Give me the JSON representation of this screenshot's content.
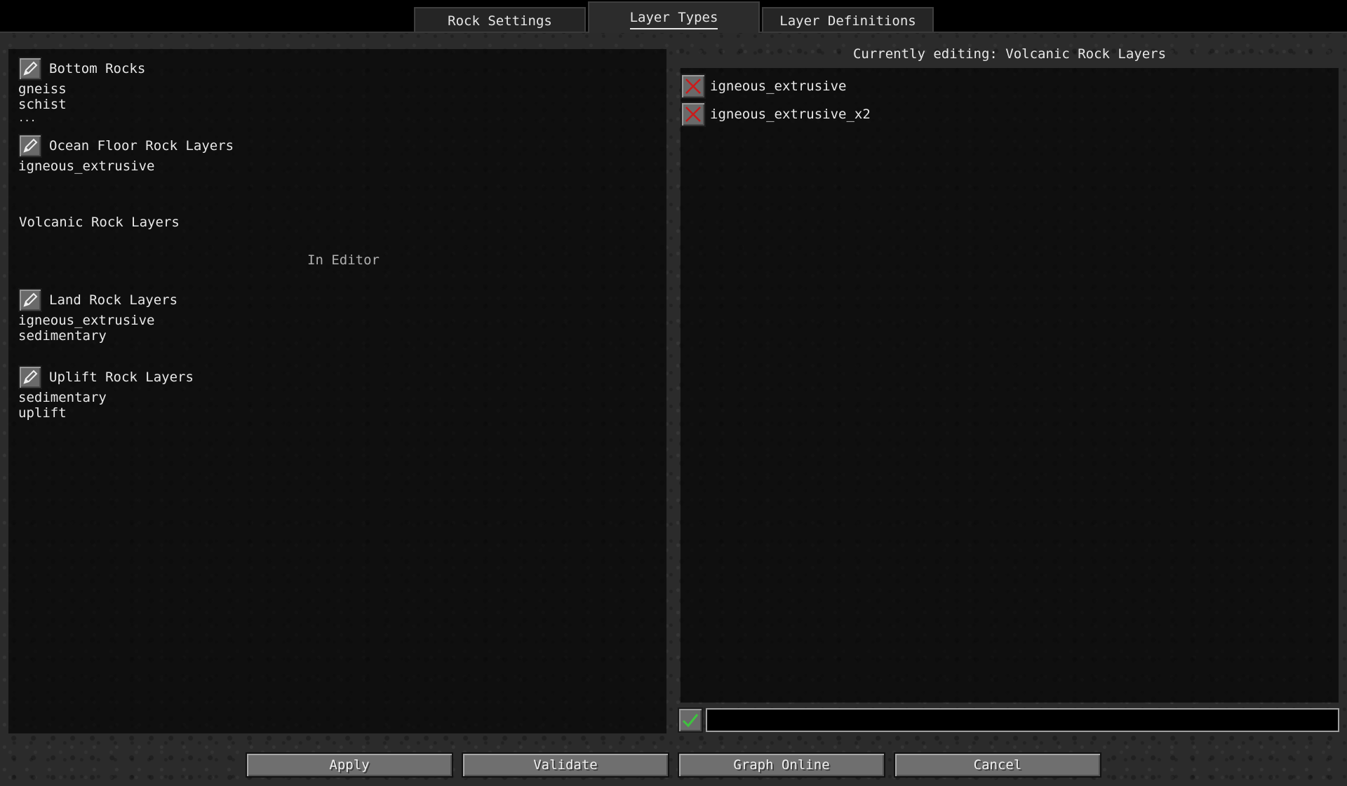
{
  "tabs": [
    {
      "label": "Rock Settings"
    },
    {
      "label": "Layer Types"
    },
    {
      "label": "Layer Definitions"
    }
  ],
  "active_tab": "Layer Types",
  "left": {
    "groups": [
      {
        "title": "Bottom Rocks",
        "items": [
          "gneiss",
          "schist",
          "..."
        ]
      },
      {
        "title": "Ocean Floor Rock Layers",
        "items": [
          "igneous_extrusive"
        ]
      },
      {
        "title": "Land Rock Layers",
        "items": [
          "igneous_extrusive",
          "sedimentary"
        ]
      },
      {
        "title": "Uplift Rock Layers",
        "items": [
          "sedimentary",
          "uplift"
        ]
      }
    ],
    "volcanic_title": "Volcanic Rock Layers",
    "in_editor_label": "In Editor"
  },
  "right": {
    "header": "Currently editing: Volcanic Rock Layers",
    "entries": [
      "igneous_extrusive",
      "igneous_extrusive_x2"
    ],
    "input_value": ""
  },
  "buttons": {
    "apply": "Apply",
    "validate": "Validate",
    "graph_online": "Graph Online",
    "cancel": "Cancel"
  },
  "icons": {
    "edit": "pencil-icon",
    "remove": "red-x-icon",
    "add": "green-check-icon"
  },
  "colors": {
    "remove_x": "#cc1a1a",
    "add_check": "#3ec43e"
  }
}
